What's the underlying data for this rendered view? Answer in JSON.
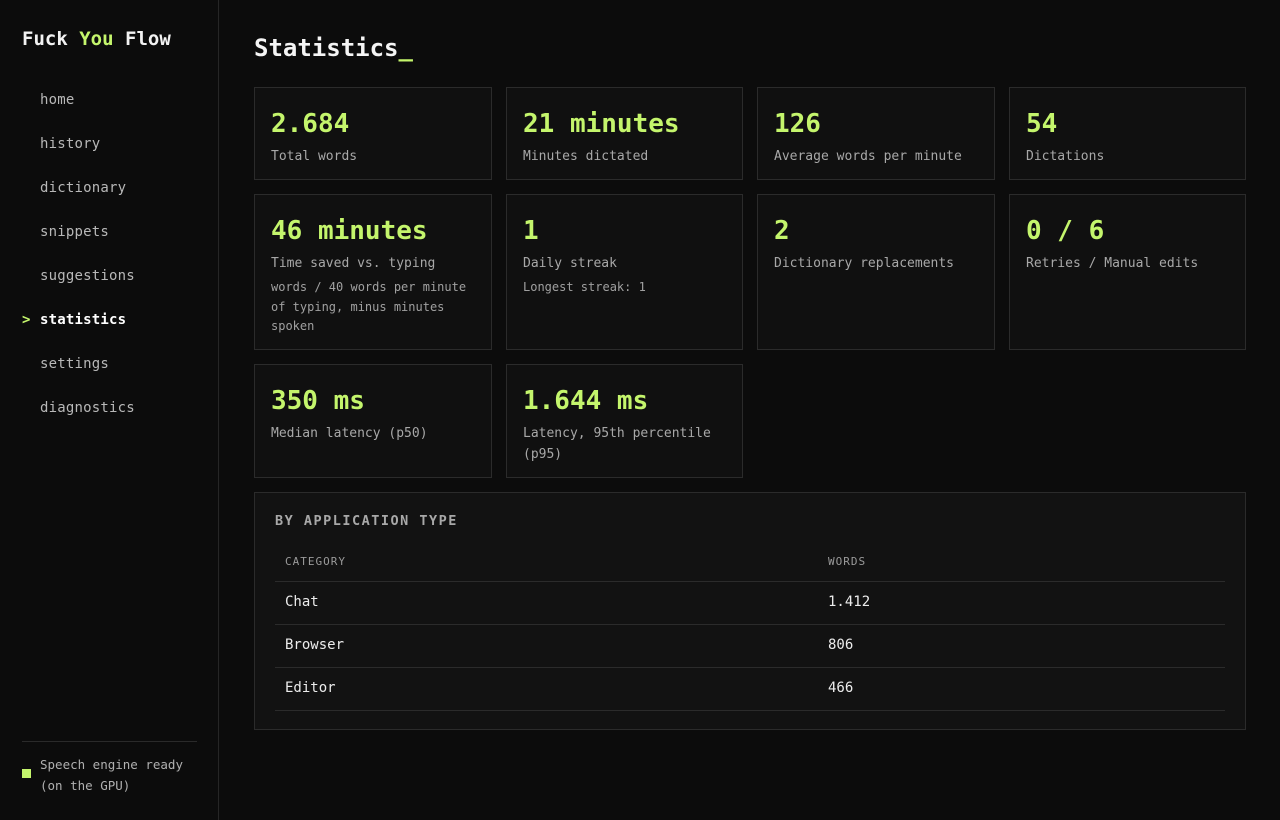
{
  "brand": {
    "part1": "Fuck",
    "part2": "You",
    "part3": "Flow"
  },
  "nav": {
    "items": [
      {
        "label": "home"
      },
      {
        "label": "history"
      },
      {
        "label": "dictionary"
      },
      {
        "label": "snippets"
      },
      {
        "label": "suggestions"
      },
      {
        "label": "statistics",
        "active": true
      },
      {
        "label": "settings"
      },
      {
        "label": "diagnostics"
      }
    ],
    "active_marker": ">"
  },
  "status": {
    "line1": "Speech engine ready",
    "line2": "(on the GPU)",
    "color": "#c4f56c"
  },
  "page": {
    "title": "Statistics",
    "cursor": "_"
  },
  "stats": [
    {
      "value": "2.684",
      "label": "Total words"
    },
    {
      "value": "21 minutes",
      "label": "Minutes dictated"
    },
    {
      "value": "126",
      "label": "Average words per minute"
    },
    {
      "value": "54",
      "label": "Dictations"
    },
    {
      "value": "46 minutes",
      "label": "Time saved vs. typing",
      "note": "words / 40 words per minute of typing, minus minutes spoken"
    },
    {
      "value": "1",
      "label": "Daily streak",
      "note": "Longest streak: 1"
    },
    {
      "value": "2",
      "label": "Dictionary replacements"
    },
    {
      "value": "0 / 6",
      "label": "Retries / Manual edits"
    },
    {
      "value": "350 ms",
      "label": "Median latency (p50)"
    },
    {
      "value": "1.644 ms",
      "label": "Latency, 95th percentile (p95)"
    }
  ],
  "by_app": {
    "title": "BY APPLICATION TYPE",
    "columns": [
      "CATEGORY",
      "WORDS"
    ],
    "rows": [
      {
        "category": "Chat",
        "words": "1.412"
      },
      {
        "category": "Browser",
        "words": "806"
      },
      {
        "category": "Editor",
        "words": "466"
      }
    ]
  },
  "colors": {
    "accent": "#c4f56c",
    "background": "#0c0c0c",
    "card_border": "#2b2b2b"
  }
}
